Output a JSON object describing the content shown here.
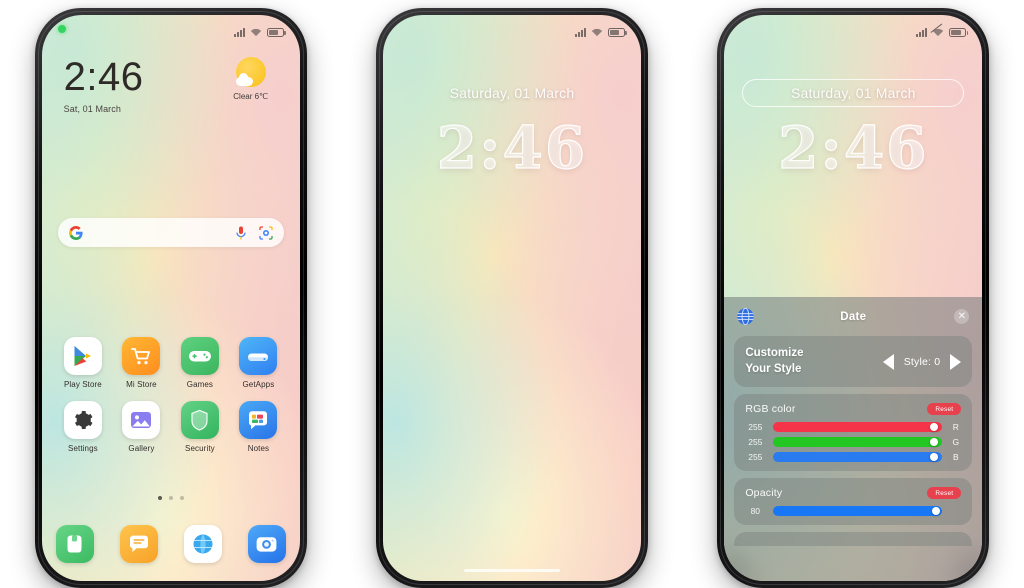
{
  "phones": [
    {
      "id": "phone-home",
      "type": "home-screen",
      "status": {
        "signal": "signal-icon",
        "wifi": "wifi-icon",
        "wifi_off": false,
        "battery": "battery-icon"
      },
      "clock": {
        "time": "2:46",
        "date": "Sat, 01 March"
      },
      "weather": {
        "icon": "sun-cloud-icon",
        "text": "Clear 6℃"
      },
      "search": {
        "logo": "google-logo-icon",
        "mic": "microphone-icon",
        "lens": "google-lens-icon",
        "placeholder": ""
      },
      "apps": [
        {
          "label": "Play Store",
          "icon": "play-store-icon"
        },
        {
          "label": "Mi Store",
          "icon": "mi-store-icon"
        },
        {
          "label": "Games",
          "icon": "games-icon"
        },
        {
          "label": "GetApps",
          "icon": "getapps-icon"
        },
        {
          "label": "Settings",
          "icon": "settings-gear-icon"
        },
        {
          "label": "Gallery",
          "icon": "gallery-icon"
        },
        {
          "label": "Security",
          "icon": "security-shield-icon"
        },
        {
          "label": "Notes",
          "icon": "notes-icon"
        }
      ],
      "page_dots": {
        "count": 3,
        "active": 0
      },
      "dock": [
        {
          "icon": "files-icon"
        },
        {
          "icon": "messages-icon"
        },
        {
          "icon": "browser-icon"
        },
        {
          "icon": "camera-icon"
        }
      ]
    },
    {
      "id": "phone-lock",
      "type": "lock-screen",
      "status": {
        "signal": "signal-icon",
        "wifi": "wifi-icon",
        "wifi_off": false,
        "battery": "battery-icon"
      },
      "date": "Saturday, 01 March",
      "time": "2:46"
    },
    {
      "id": "phone-editor",
      "type": "lock-screen-editor",
      "status": {
        "signal": "signal-icon",
        "wifi": "wifi-icon",
        "wifi_off": true,
        "battery": "battery-icon"
      },
      "date": "Saturday, 01 March",
      "time": "2:46",
      "editor": {
        "globe_icon": "globe-icon",
        "title": "Date",
        "close_icon": "close-icon",
        "style": {
          "label_line1": "Customize",
          "label_line2": "Your Style",
          "prev_icon": "arrow-left-icon",
          "next_icon": "arrow-right-icon",
          "value": "Style: 0"
        },
        "rgb": {
          "title": "RGB color",
          "reset_label": "Reset",
          "channels": [
            {
              "value": "255",
              "tag": "R",
              "color": "#f5344a",
              "percent": 100
            },
            {
              "value": "255",
              "tag": "G",
              "color": "#22c722",
              "percent": 100
            },
            {
              "value": "255",
              "tag": "B",
              "color": "#2a7af0",
              "percent": 100
            }
          ]
        },
        "opacity": {
          "title": "Opacity",
          "reset_label": "Reset",
          "value": "80",
          "color": "#1877f5",
          "percent": 96
        }
      }
    }
  ]
}
